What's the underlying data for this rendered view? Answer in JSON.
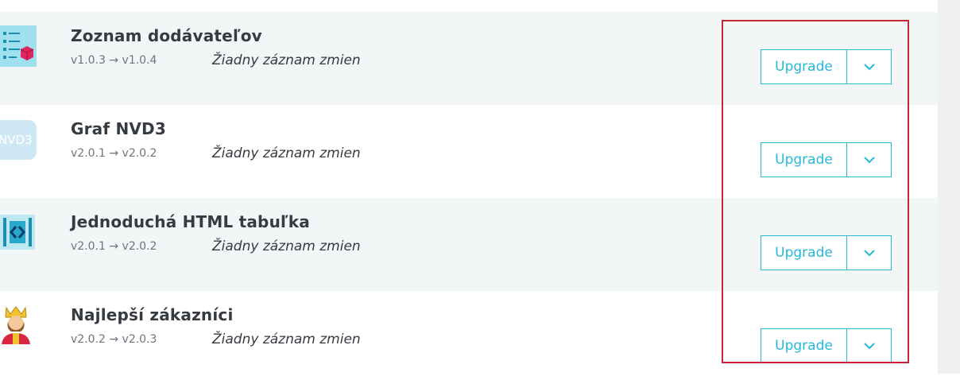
{
  "modules": [
    {
      "name": "Zoznam dodávateľov",
      "version": "v1.0.3 → v1.0.4",
      "changelog": "Žiadny záznam zmien",
      "upgrade_label": "Upgrade",
      "icon": "supplier-list-icon"
    },
    {
      "name": "Graf NVD3",
      "version": "v2.0.1 → v2.0.2",
      "changelog": "Žiadny záznam zmien",
      "upgrade_label": "Upgrade",
      "icon": "nvd3-icon",
      "icon_text": "NVD3"
    },
    {
      "name": "Jednoduchá HTML tabuľka",
      "version": "v2.0.1 → v2.0.2",
      "changelog": "Žiadny záznam zmien",
      "upgrade_label": "Upgrade",
      "icon": "html-table-icon"
    },
    {
      "name": "Najlepší zákazníci",
      "version": "v2.0.2 → v2.0.3",
      "changelog": "Žiadny záznam zmien",
      "upgrade_label": "Upgrade",
      "icon": "king-icon"
    }
  ],
  "colors": {
    "accent": "#25b9d7",
    "highlight": "#c52834",
    "row_alt": "#f2f6f7"
  }
}
